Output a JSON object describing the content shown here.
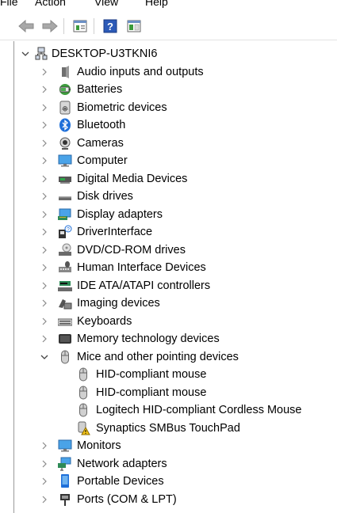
{
  "menu": [
    "File",
    "Action",
    "View",
    "Help"
  ],
  "tree": {
    "root": {
      "label": "DESKTOP-U3TKNI6",
      "icon": "computer-network-icon"
    },
    "categories": [
      {
        "label": "Audio inputs and outputs",
        "icon": "speaker-icon"
      },
      {
        "label": "Batteries",
        "icon": "battery-icon"
      },
      {
        "label": "Biometric devices",
        "icon": "fingerprint-icon"
      },
      {
        "label": "Bluetooth",
        "icon": "bluetooth-icon"
      },
      {
        "label": "Cameras",
        "icon": "webcam-icon"
      },
      {
        "label": "Computer",
        "icon": "monitor-icon"
      },
      {
        "label": "Digital Media Devices",
        "icon": "media-device-icon"
      },
      {
        "label": "Disk drives",
        "icon": "disk-drive-icon"
      },
      {
        "label": "Display adapters",
        "icon": "display-adapter-icon"
      },
      {
        "label": "DriverInterface",
        "icon": "driver-interface-icon"
      },
      {
        "label": "DVD/CD-ROM drives",
        "icon": "dvd-drive-icon"
      },
      {
        "label": "Human Interface Devices",
        "icon": "hid-icon"
      },
      {
        "label": "IDE ATA/ATAPI controllers",
        "icon": "ide-controller-icon"
      },
      {
        "label": "Imaging devices",
        "icon": "imaging-device-icon"
      },
      {
        "label": "Keyboards",
        "icon": "keyboard-icon"
      },
      {
        "label": "Memory technology devices",
        "icon": "memory-card-icon"
      },
      {
        "label": "Mice and other pointing devices",
        "icon": "mouse-icon",
        "expanded": true,
        "children": [
          {
            "label": "HID-compliant mouse",
            "icon": "mouse-icon"
          },
          {
            "label": "HID-compliant mouse",
            "icon": "mouse-icon"
          },
          {
            "label": "Logitech HID-compliant Cordless Mouse",
            "icon": "mouse-icon"
          },
          {
            "label": "Synaptics SMBus TouchPad",
            "icon": "touchpad-warning-icon"
          }
        ]
      },
      {
        "label": "Monitors",
        "icon": "monitor-icon"
      },
      {
        "label": "Network adapters",
        "icon": "network-adapter-icon"
      },
      {
        "label": "Portable Devices",
        "icon": "portable-device-icon"
      },
      {
        "label": "Ports (COM & LPT)",
        "icon": "port-icon"
      }
    ]
  }
}
